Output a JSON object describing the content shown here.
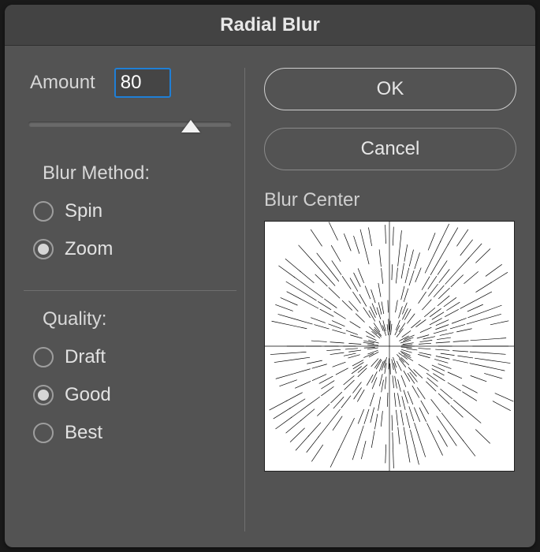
{
  "title": "Radial Blur",
  "amount": {
    "label": "Amount",
    "value": "80",
    "pct": 80
  },
  "blur_method": {
    "heading": "Blur Method:",
    "options": [
      {
        "label": "Spin",
        "selected": false
      },
      {
        "label": "Zoom",
        "selected": true
      }
    ]
  },
  "quality": {
    "heading": "Quality:",
    "options": [
      {
        "label": "Draft",
        "selected": false
      },
      {
        "label": "Good",
        "selected": true
      },
      {
        "label": "Best",
        "selected": false
      }
    ]
  },
  "blur_center_label": "Blur Center",
  "buttons": {
    "ok": "OK",
    "cancel": "Cancel"
  }
}
